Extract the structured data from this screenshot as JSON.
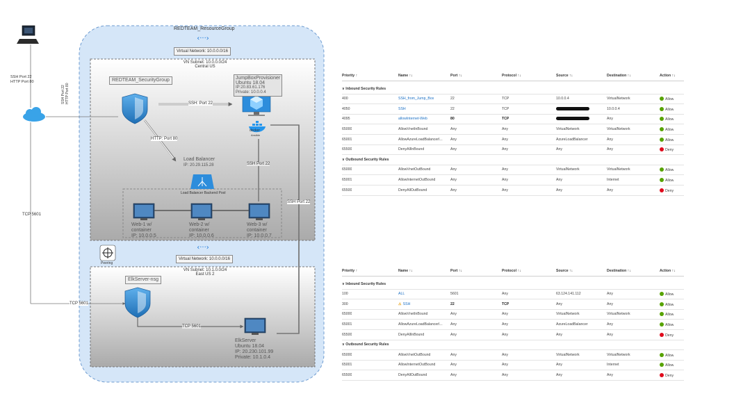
{
  "diagram": {
    "resource_group": "REDTEAM_ResourceGroup",
    "vnet1": "Virtual Network: 10.0.0.0/16",
    "subnet1": [
      "VN Subnet: 10.0.0.0/24",
      "Central US"
    ],
    "security_group": "REDTEAM_SecurityGroup",
    "jumpbox": [
      "JumpBoxProvisioner",
      "Ubuntu 18.04",
      "IP:20.83.61.176",
      "Private: 10.0.0.4"
    ],
    "docker_label": "docker",
    "docker_sub": "Ansible",
    "ssh_in_label": [
      "SSH Port 22",
      "HTTP Port 80"
    ],
    "ssh_in_label2": [
      "SSH Port 22",
      "HTTP Port 80"
    ],
    "ssh_sg_jump": "SSH: Port 22",
    "http_sg_lb": "HTTP: Port 80",
    "lb": [
      "Load Balancer",
      "IP: 20.29.115.28"
    ],
    "pool": "Load Balancer Backend Pool",
    "ssh_jump_pool": "SSH Port 22",
    "ssh_elk": "SSH Port 22",
    "web1": [
      "Web-1 w/",
      "container",
      "IP: 10.0.0.5"
    ],
    "web2": [
      "Web-2 w/",
      "container",
      "IP: 10.0.0.6"
    ],
    "web3": [
      "Web-3 w/",
      "container",
      "IP: 10.0.0.7"
    ],
    "peering": "Peering",
    "vnet2": "Virtual Network: 10.0.0.0/16",
    "subnet2": [
      "VN Subnet: 10.1.0.0/24",
      "East US 2"
    ],
    "elk_nsg": "ElkServer-nsg",
    "tcp_left": "TCP 5601",
    "tcp_mid": "TCP 5601",
    "tcp_elk": "TCP 5601",
    "elk": [
      "ElkServer",
      "Ubuntu 18.04",
      "IP: 20.230.101.99",
      "Private: 10.1.0.4"
    ]
  },
  "table1": {
    "headers": [
      "Priority ↑",
      "Name ↑↓",
      "Port ↑↓",
      "Protocol ↑↓",
      "Source ↑↓",
      "Destination ↑↓",
      "Action ↑↓"
    ],
    "inbound_title": "Inbound Security Rules",
    "outbound_title": "Outbound Security Rules",
    "inbound": [
      {
        "p": "400",
        "n": "SSH_from_Jump_Box",
        "port": "22",
        "proto": "TCP",
        "src": "10.0.0.4",
        "dst": "VirtualNetwork",
        "act": "Allow",
        "link": true
      },
      {
        "p": "4050",
        "n": "SSH",
        "port": "22",
        "proto": "TCP",
        "src": "",
        "dst": "10.0.0.4",
        "act": "Allow",
        "link": true,
        "redact": true
      },
      {
        "p": "4095",
        "n": "allowInternet-Web",
        "port": "80",
        "proto": "TCP",
        "src": "",
        "dst": "Any",
        "act": "Allow",
        "link": true,
        "redact": true,
        "bold": true
      },
      {
        "p": "65000",
        "n": "AllowVnetInBound",
        "port": "Any",
        "proto": "Any",
        "src": "VirtualNetwork",
        "dst": "VirtualNetwork",
        "act": "Allow"
      },
      {
        "p": "65001",
        "n": "AllowAzureLoadBalancerI...",
        "port": "Any",
        "proto": "Any",
        "src": "AzureLoadBalancer",
        "dst": "Any",
        "act": "Allow"
      },
      {
        "p": "65500",
        "n": "DenyAllInBound",
        "port": "Any",
        "proto": "Any",
        "src": "Any",
        "dst": "Any",
        "act": "Deny"
      }
    ],
    "outbound": [
      {
        "p": "65000",
        "n": "AllowVnetOutBound",
        "port": "Any",
        "proto": "Any",
        "src": "VirtualNetwork",
        "dst": "VirtualNetwork",
        "act": "Allow"
      },
      {
        "p": "65001",
        "n": "AllowInternetOutBound",
        "port": "Any",
        "proto": "Any",
        "src": "Any",
        "dst": "Internet",
        "act": "Allow"
      },
      {
        "p": "65500",
        "n": "DenyAllOutBound",
        "port": "Any",
        "proto": "Any",
        "src": "Any",
        "dst": "Any",
        "act": "Deny"
      }
    ]
  },
  "table2": {
    "headers": [
      "Priority ↑",
      "Name ↑↓",
      "Port ↑↓",
      "Protocol ↑↓",
      "Source ↑↓",
      "Destination ↑↓",
      "Action ↑↓"
    ],
    "inbound_title": "Inbound Security Rules",
    "outbound_title": "Outbound Security Rules",
    "inbound": [
      {
        "p": "100",
        "n": "ALL",
        "port": "5601",
        "proto": "Any",
        "src": "63.124.141.112",
        "dst": "Any",
        "act": "Allow",
        "link": true
      },
      {
        "p": "300",
        "n": "SSH",
        "port": "22",
        "proto": "TCP",
        "src": "Any",
        "dst": "Any",
        "act": "Allow",
        "link": true,
        "warn": true,
        "bold": true
      },
      {
        "p": "65000",
        "n": "AllowVnetInBound",
        "port": "Any",
        "proto": "Any",
        "src": "VirtualNetwork",
        "dst": "VirtualNetwork",
        "act": "Allow"
      },
      {
        "p": "65001",
        "n": "AllowAzureLoadBalancerI...",
        "port": "Any",
        "proto": "Any",
        "src": "AzureLoadBalancer",
        "dst": "Any",
        "act": "Allow"
      },
      {
        "p": "65500",
        "n": "DenyAllInBound",
        "port": "Any",
        "proto": "Any",
        "src": "Any",
        "dst": "Any",
        "act": "Deny"
      }
    ],
    "outbound": [
      {
        "p": "65000",
        "n": "AllowVnetOutBound",
        "port": "Any",
        "proto": "Any",
        "src": "VirtualNetwork",
        "dst": "VirtualNetwork",
        "act": "Allow"
      },
      {
        "p": "65001",
        "n": "AllowInternetOutBound",
        "port": "Any",
        "proto": "Any",
        "src": "Any",
        "dst": "Internet",
        "act": "Allow"
      },
      {
        "p": "65500",
        "n": "DenyAllOutBound",
        "port": "Any",
        "proto": "Any",
        "src": "Any",
        "dst": "Any",
        "act": "Deny"
      }
    ]
  }
}
